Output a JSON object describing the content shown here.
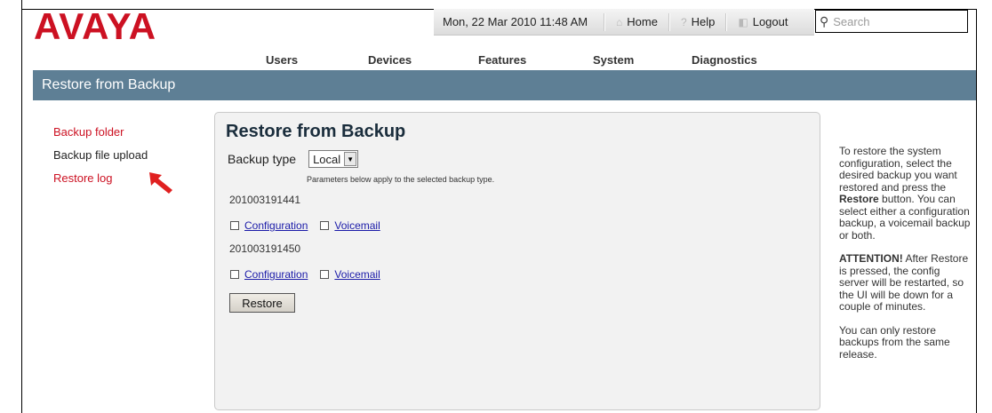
{
  "brand": {
    "logo_text": "AVAYA",
    "logo_color": "#cc1122"
  },
  "topbar": {
    "datetime": "Mon, 22 Mar 2010 11:48 AM",
    "home_label": "Home",
    "help_label": "Help",
    "logout_label": "Logout",
    "search_placeholder": "Search"
  },
  "menu": {
    "items": [
      "Users",
      "Devices",
      "Features",
      "System",
      "Diagnostics"
    ]
  },
  "page": {
    "title_bar": "Restore from Backup",
    "title_bar_color": "#5e7f95"
  },
  "sidebar": {
    "items": [
      {
        "label": "Backup folder",
        "state": "active"
      },
      {
        "label": "Backup file upload",
        "state": "normal"
      },
      {
        "label": "Restore log",
        "state": "active"
      }
    ]
  },
  "main": {
    "heading": "Restore from Backup",
    "backup_type_label": "Backup type",
    "backup_type_value": "Local",
    "note": "Parameters below apply to the selected backup type.",
    "backups": [
      {
        "name": "201003191441",
        "options": [
          "Configuration",
          "Voicemail"
        ]
      },
      {
        "name": "201003191450",
        "options": [
          "Configuration",
          "Voicemail"
        ]
      }
    ],
    "restore_button": "Restore"
  },
  "help": {
    "para1_a": "To restore the system configuration, select the desired backup you want restored and press the ",
    "para1_bold": "Restore",
    "para1_b": " button. You can select either a configuration backup, a voicemail backup or both.",
    "para2_bold": "ATTENTION!",
    "para2": " After Restore is pressed, the config server will be restarted, so the UI will be down for a couple of minutes.",
    "para3": "You can only restore backups from the same release."
  },
  "colors": {
    "link": "#1a1aa8",
    "active_nav": "#cc1122"
  }
}
